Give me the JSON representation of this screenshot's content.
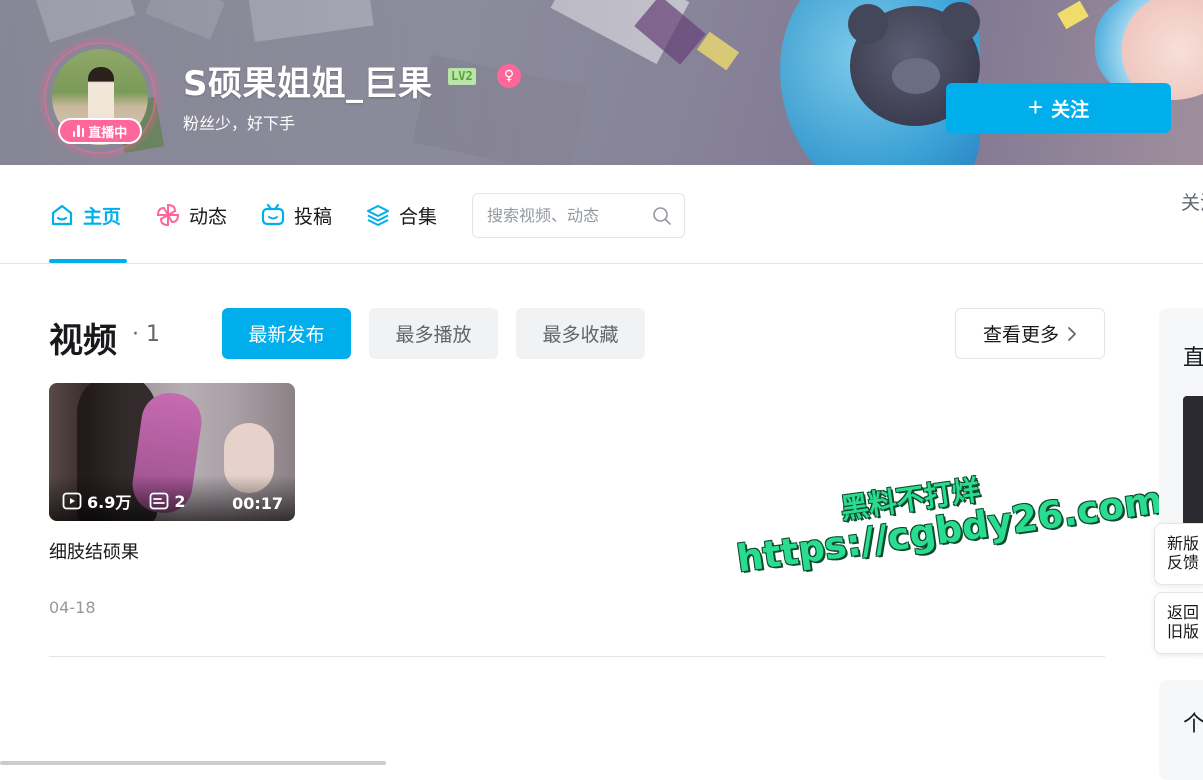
{
  "profile": {
    "username": "S硕果姐姐_巨果",
    "level": "LV2",
    "signature": "粉丝少，好下手",
    "live_badge": "直播中",
    "follow_label": "关注"
  },
  "nav": {
    "tabs": [
      {
        "label": "主页",
        "active": true
      },
      {
        "label": "动态",
        "active": false
      },
      {
        "label": "投稿",
        "active": false
      },
      {
        "label": "合集",
        "active": false
      }
    ],
    "search_placeholder": "搜索视频、动态",
    "cut_text": "关注"
  },
  "videos_section": {
    "title": "视频",
    "count": "· 1",
    "sort_tabs": [
      "最新发布",
      "最多播放",
      "最多收藏"
    ],
    "more_label": "查看更多"
  },
  "videos": [
    {
      "title": "细肢结硕果",
      "views": "6.9万",
      "comments": "2",
      "duration": "00:17",
      "date": "04-18"
    }
  ],
  "sidebar": {
    "card1_title": "直",
    "card2_title": "个",
    "feedback": "新版反馈",
    "back_old": "返回旧版"
  },
  "watermark": {
    "line1": "黑料不打烊",
    "line2": "https://cgbdy26.com"
  },
  "colors": {
    "accent": "#00aeec",
    "live": "#ff6699",
    "level_bg": "#b9e6a8"
  }
}
